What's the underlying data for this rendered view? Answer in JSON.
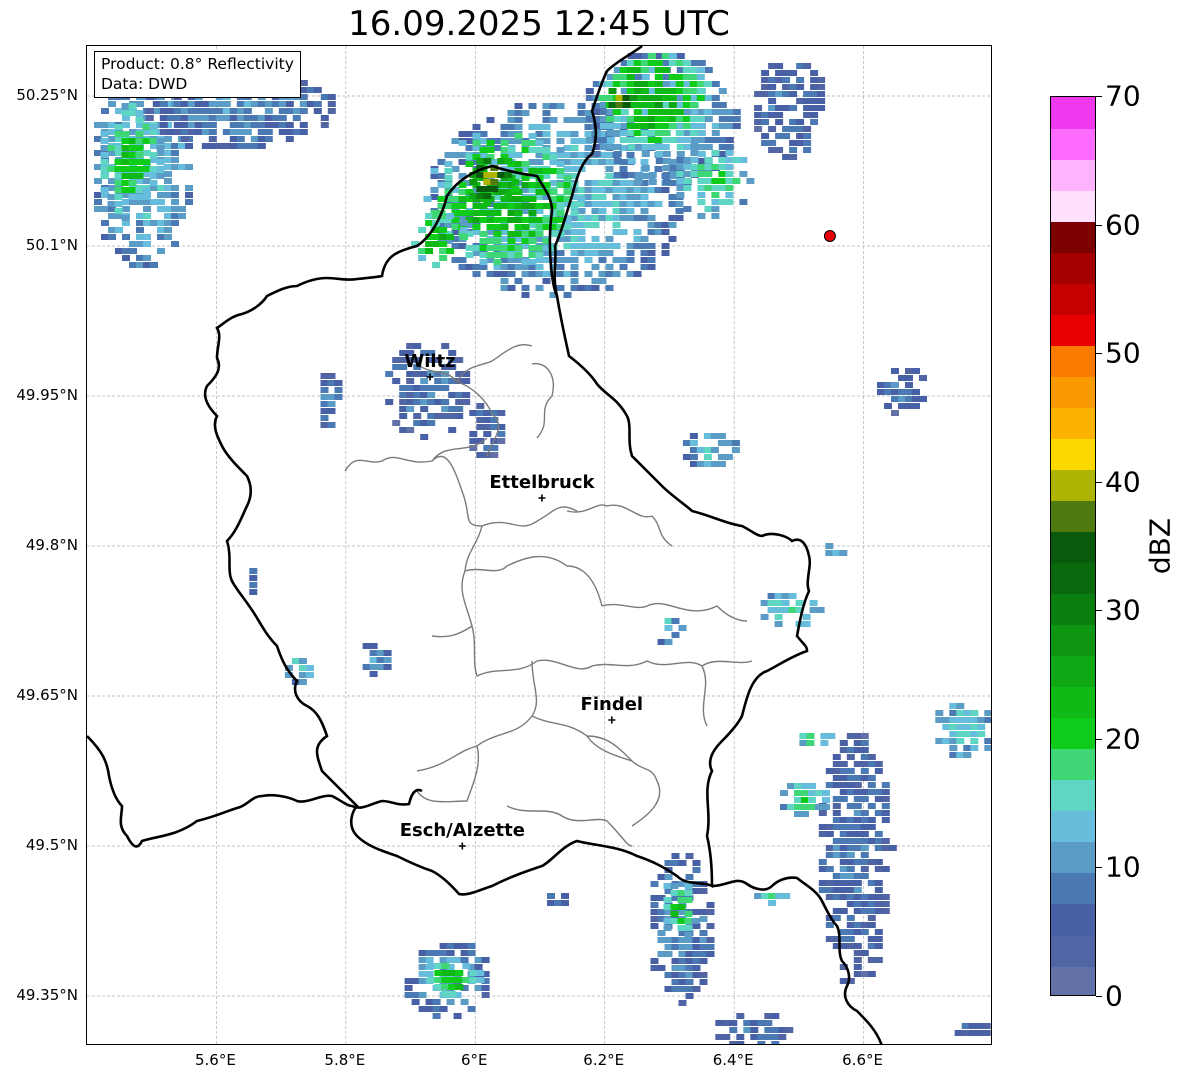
{
  "title": "16.09.2025 12:45 UTC",
  "info": {
    "product": "Product: 0.8° Reflectivity",
    "source": "Data: DWD"
  },
  "map": {
    "lon_range": [
      5.4,
      6.8
    ],
    "lat_range": [
      49.3,
      50.3
    ],
    "lat_ticks": [
      {
        "v": 50.25,
        "label": "50.25°N"
      },
      {
        "v": 50.1,
        "label": "50.1°N"
      },
      {
        "v": 49.95,
        "label": "49.95°N"
      },
      {
        "v": 49.8,
        "label": "49.8°N"
      },
      {
        "v": 49.65,
        "label": "49.65°N"
      },
      {
        "v": 49.5,
        "label": "49.5°N"
      },
      {
        "v": 49.35,
        "label": "49.35°N"
      }
    ],
    "lon_ticks": [
      {
        "v": 5.6,
        "label": "5.6°E"
      },
      {
        "v": 5.8,
        "label": "5.8°E"
      },
      {
        "v": 6.0,
        "label": "6°E"
      },
      {
        "v": 6.2,
        "label": "6.2°E"
      },
      {
        "v": 6.4,
        "label": "6.4°E"
      },
      {
        "v": 6.6,
        "label": "6.6°E"
      }
    ],
    "cities": [
      {
        "name": "Wiltz",
        "lon": 5.93,
        "lat": 49.969
      },
      {
        "name": "Ettelbruck",
        "lon": 6.103,
        "lat": 49.848
      },
      {
        "name": "Findel",
        "lon": 6.211,
        "lat": 49.626
      },
      {
        "name": "Esch/Alzette",
        "lon": 5.98,
        "lat": 49.5
      }
    ],
    "marker": {
      "lon": 6.548,
      "lat": 50.11,
      "color": "#e8000b"
    },
    "echoes": [
      {
        "lon": 6.12,
        "lat": 50.15,
        "rx": 0.2,
        "ry": 0.1,
        "dbz": 14
      },
      {
        "lon": 6.04,
        "lat": 50.15,
        "rx": 0.12,
        "ry": 0.07,
        "dbz": 24
      },
      {
        "lon": 6.02,
        "lat": 50.17,
        "rx": 0.04,
        "ry": 0.025,
        "dbz": 39
      },
      {
        "lon": 5.94,
        "lat": 50.11,
        "rx": 0.05,
        "ry": 0.03,
        "dbz": 22
      },
      {
        "lon": 6.28,
        "lat": 50.23,
        "rx": 0.12,
        "ry": 0.07,
        "dbz": 14
      },
      {
        "lon": 6.27,
        "lat": 50.25,
        "rx": 0.09,
        "ry": 0.05,
        "dbz": 25
      },
      {
        "lon": 6.22,
        "lat": 50.25,
        "rx": 0.025,
        "ry": 0.015,
        "dbz": 39
      },
      {
        "lon": 6.36,
        "lat": 50.17,
        "rx": 0.06,
        "ry": 0.04,
        "dbz": 18
      },
      {
        "lon": 6.48,
        "lat": 50.24,
        "rx": 0.06,
        "ry": 0.05,
        "dbz": 8
      },
      {
        "lon": 5.48,
        "lat": 50.18,
        "rx": 0.08,
        "ry": 0.1,
        "dbz": 14
      },
      {
        "lon": 5.46,
        "lat": 50.19,
        "rx": 0.05,
        "ry": 0.06,
        "dbz": 21
      },
      {
        "lon": 5.63,
        "lat": 50.24,
        "rx": 0.15,
        "ry": 0.04,
        "dbz": 10
      },
      {
        "lon": 5.92,
        "lat": 49.96,
        "rx": 0.07,
        "ry": 0.05,
        "dbz": 8
      },
      {
        "lon": 6.01,
        "lat": 49.92,
        "rx": 0.03,
        "ry": 0.03,
        "dbz": 7
      },
      {
        "lon": 5.77,
        "lat": 49.95,
        "rx": 0.02,
        "ry": 0.03,
        "dbz": 9
      },
      {
        "lon": 6.36,
        "lat": 49.9,
        "rx": 0.05,
        "ry": 0.02,
        "dbz": 14
      },
      {
        "lon": 6.65,
        "lat": 49.96,
        "rx": 0.04,
        "ry": 0.025,
        "dbz": 8
      },
      {
        "lon": 6.48,
        "lat": 49.74,
        "rx": 0.05,
        "ry": 0.02,
        "dbz": 16
      },
      {
        "lon": 6.29,
        "lat": 49.72,
        "rx": 0.03,
        "ry": 0.015,
        "dbz": 14
      },
      {
        "lon": 5.72,
        "lat": 49.68,
        "rx": 0.025,
        "ry": 0.015,
        "dbz": 15
      },
      {
        "lon": 5.84,
        "lat": 49.69,
        "rx": 0.025,
        "ry": 0.02,
        "dbz": 10
      },
      {
        "lon": 5.65,
        "lat": 49.76,
        "rx": 0.01,
        "ry": 0.025,
        "dbz": 8
      },
      {
        "lon": 6.75,
        "lat": 49.62,
        "rx": 0.05,
        "ry": 0.03,
        "dbz": 15
      },
      {
        "lon": 6.52,
        "lat": 49.61,
        "rx": 0.03,
        "ry": 0.01,
        "dbz": 18
      },
      {
        "lon": 6.58,
        "lat": 49.49,
        "rx": 0.06,
        "ry": 0.13,
        "dbz": 8
      },
      {
        "lon": 6.5,
        "lat": 49.55,
        "rx": 0.04,
        "ry": 0.02,
        "dbz": 18
      },
      {
        "lon": 6.31,
        "lat": 49.42,
        "rx": 0.05,
        "ry": 0.08,
        "dbz": 10
      },
      {
        "lon": 6.31,
        "lat": 49.44,
        "rx": 0.03,
        "ry": 0.03,
        "dbz": 20
      },
      {
        "lon": 5.95,
        "lat": 49.37,
        "rx": 0.07,
        "ry": 0.04,
        "dbz": 12
      },
      {
        "lon": 5.96,
        "lat": 49.37,
        "rx": 0.045,
        "ry": 0.02,
        "dbz": 22
      },
      {
        "lon": 6.42,
        "lat": 49.32,
        "rx": 0.06,
        "ry": 0.02,
        "dbz": 9
      },
      {
        "lon": 6.12,
        "lat": 49.45,
        "rx": 0.02,
        "ry": 0.01,
        "dbz": 8
      },
      {
        "lon": 6.45,
        "lat": 49.45,
        "rx": 0.03,
        "ry": 0.01,
        "dbz": 16
      },
      {
        "lon": 6.76,
        "lat": 49.32,
        "rx": 0.03,
        "ry": 0.01,
        "dbz": 7
      },
      {
        "lon": 6.55,
        "lat": 49.8,
        "rx": 0.02,
        "ry": 0.01,
        "dbz": 12
      }
    ]
  },
  "colorbar": {
    "label": "dBZ",
    "min": 0,
    "max": 70,
    "ticks": [
      "0",
      "10",
      "20",
      "30",
      "40",
      "50",
      "60",
      "70"
    ],
    "colors": [
      "#6272a8",
      "#5164a4",
      "#4860a6",
      "#4a79b4",
      "#5a9cc6",
      "#67bedc",
      "#5fd6c3",
      "#3fd775",
      "#10cc1a",
      "#10ba16",
      "#0fa714",
      "#0e9512",
      "#0a7f10",
      "#096a0d",
      "#095a0c",
      "#4e7a0f",
      "#aeb404",
      "#fad800",
      "#fbb300",
      "#fb9900",
      "#fb7b00",
      "#e80000",
      "#c50000",
      "#a40000",
      "#7c0000",
      "#ffe1ff",
      "#ffb3ff",
      "#ff6cff",
      "#ee39ee"
    ]
  }
}
